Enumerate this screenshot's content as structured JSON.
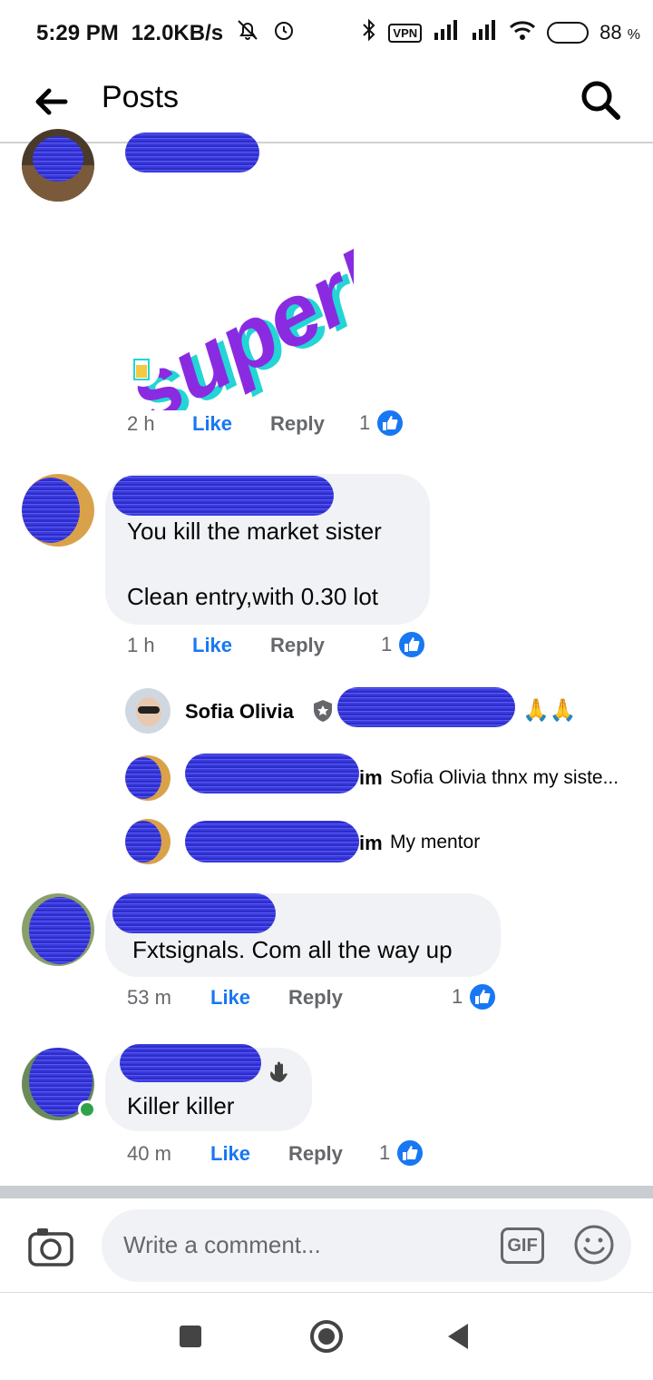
{
  "status_bar": {
    "time": "5:29 PM",
    "speed": "12.0KB/s",
    "vpn": "VPN",
    "battery": "88",
    "battery_unit": "%"
  },
  "app_bar": {
    "title": "Posts"
  },
  "comments": [
    {
      "sticker_text": "super!",
      "time": "2 h",
      "like_label": "Like",
      "reply_label": "Reply",
      "reaction_count": "1"
    },
    {
      "text_line1": "You kill the market sister",
      "text_line2": "Clean entry,with 0.30 lot",
      "time": "1 h",
      "like_label": "Like",
      "reply_label": "Reply",
      "reaction_count": "1",
      "replies": [
        {
          "name": "Sofia Olivia",
          "suffix": "🙏🙏"
        },
        {
          "name_tail": "im",
          "text": "Sofia Olivia thnx my siste..."
        },
        {
          "name_tail": "im",
          "text": "My mentor"
        }
      ]
    },
    {
      "text": "Fxtsignals. Com all the way up",
      "time": "53 m",
      "like_label": "Like",
      "reply_label": "Reply",
      "reaction_count": "1"
    },
    {
      "text": "Killer killer",
      "time": "40 m",
      "like_label": "Like",
      "reply_label": "Reply",
      "reaction_count": "1"
    }
  ],
  "composer": {
    "placeholder": "Write a comment...",
    "gif_label": "GIF"
  },
  "colors": {
    "accent": "#1877f2",
    "bubble": "#f0f2f5",
    "sticker": "#8a2be2",
    "redaction": "#3a3adf"
  }
}
